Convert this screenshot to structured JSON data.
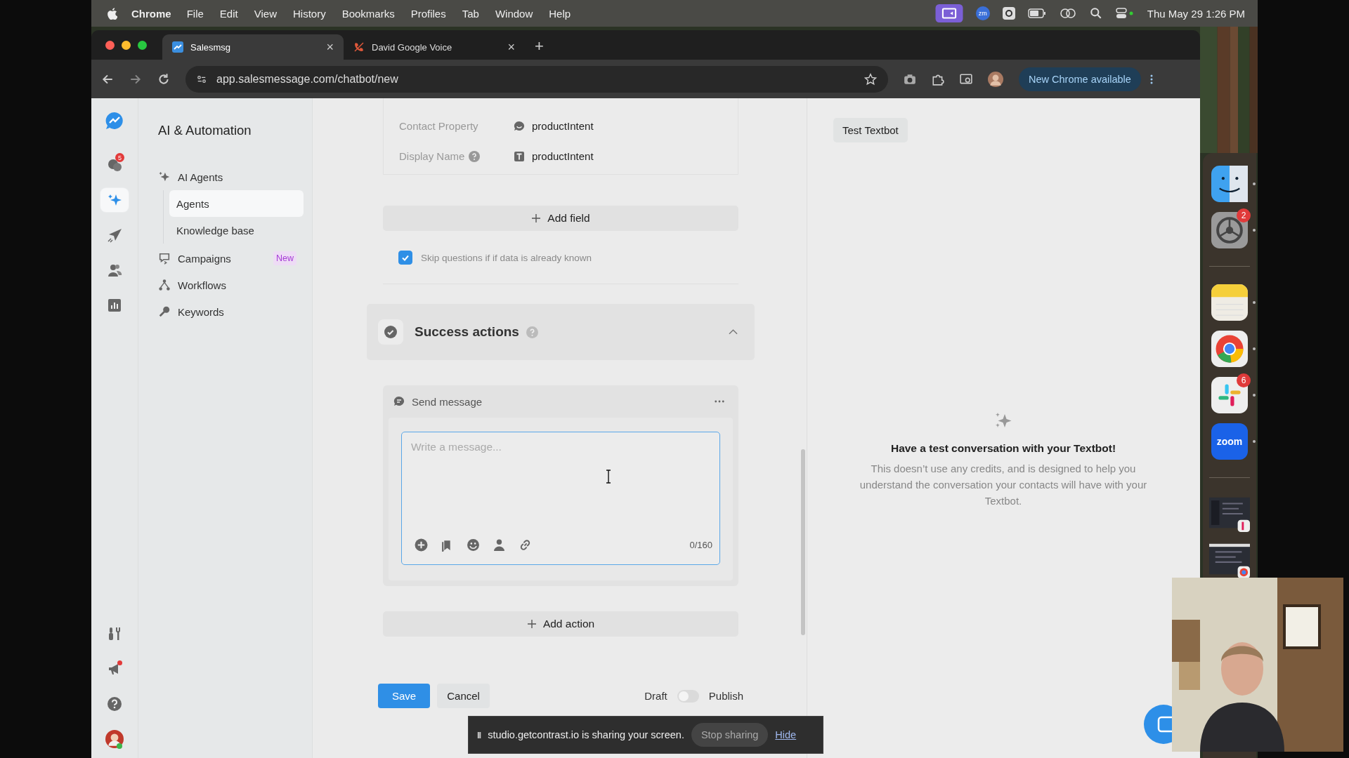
{
  "menu_bar": {
    "app": "Chrome",
    "items": [
      "File",
      "Edit",
      "View",
      "History",
      "Bookmarks",
      "Profiles",
      "Tab",
      "Window",
      "Help"
    ],
    "zoom_label": "zm",
    "clock": "Thu May 29  1:26 PM"
  },
  "browser": {
    "tabs": [
      {
        "title": "Salesmsg",
        "selected": true,
        "close": "×"
      },
      {
        "title": "David Google Voice",
        "selected": false,
        "close": "×"
      }
    ],
    "new_tab": "+",
    "url": "app.salesmessage.com/chatbot/new",
    "update_button": "New Chrome available"
  },
  "rail": {
    "top": [
      {
        "selected": false,
        "badge": "5"
      },
      {
        "selected": true
      },
      {
        "selected": false
      },
      {
        "selected": false
      },
      {
        "selected": false
      }
    ],
    "bottom": [
      {
        "alert": false
      },
      {
        "alert": true
      },
      {
        "alert": false
      }
    ],
    "avatar": {
      "online": true
    }
  },
  "sidebar": {
    "title": "AI & Automation",
    "items": [
      {
        "label": "AI Agents",
        "selected": false,
        "children": [
          {
            "label": "Agents",
            "selected": true
          },
          {
            "label": "Knowledge base",
            "selected": false
          }
        ]
      },
      {
        "label": "Campaigns",
        "selected": false,
        "badge": "New"
      },
      {
        "label": "Workflows",
        "selected": false
      },
      {
        "label": "Keywords",
        "selected": false
      }
    ]
  },
  "form": {
    "fields": [
      {
        "label": "Contact Property",
        "help": false,
        "kind": "property",
        "value": "productIntent"
      },
      {
        "label": "Display Name",
        "help": true,
        "kind": "text",
        "value": "productIntent"
      }
    ],
    "add_field": "Add field",
    "skip": {
      "label": "Skip questions if if data is already known",
      "checked": true
    },
    "section": {
      "title": "Success actions",
      "help": true,
      "expanded": true
    },
    "action": {
      "title": "Send message",
      "placeholder": "Write a message...",
      "counter": "0/160"
    },
    "add_action": "Add action",
    "save": "Save",
    "cancel": "Cancel",
    "toggle": {
      "off_label": "Draft",
      "on_label": "Publish",
      "on": false
    }
  },
  "test_panel": {
    "button": "Test Textbot",
    "heading": "Have a test conversation with your Textbot!",
    "text": "This doesn’t use any credits, and is designed to help you understand the conversation your contacts will have with your Textbot."
  },
  "dock": {
    "items": [
      {
        "kind": "app"
      },
      {
        "kind": "app",
        "badge": "2"
      },
      {
        "kind": "divider"
      },
      {
        "kind": "app"
      },
      {
        "kind": "app"
      },
      {
        "kind": "app",
        "badge": "6"
      },
      {
        "kind": "app",
        "label": "zoom"
      },
      {
        "kind": "divider"
      },
      {
        "kind": "window"
      },
      {
        "kind": "window"
      }
    ]
  },
  "share_bar": {
    "pause": "II",
    "text": "studio.getcontrast.io is sharing your screen.",
    "stop": "Stop sharing",
    "hide": "Hide"
  }
}
